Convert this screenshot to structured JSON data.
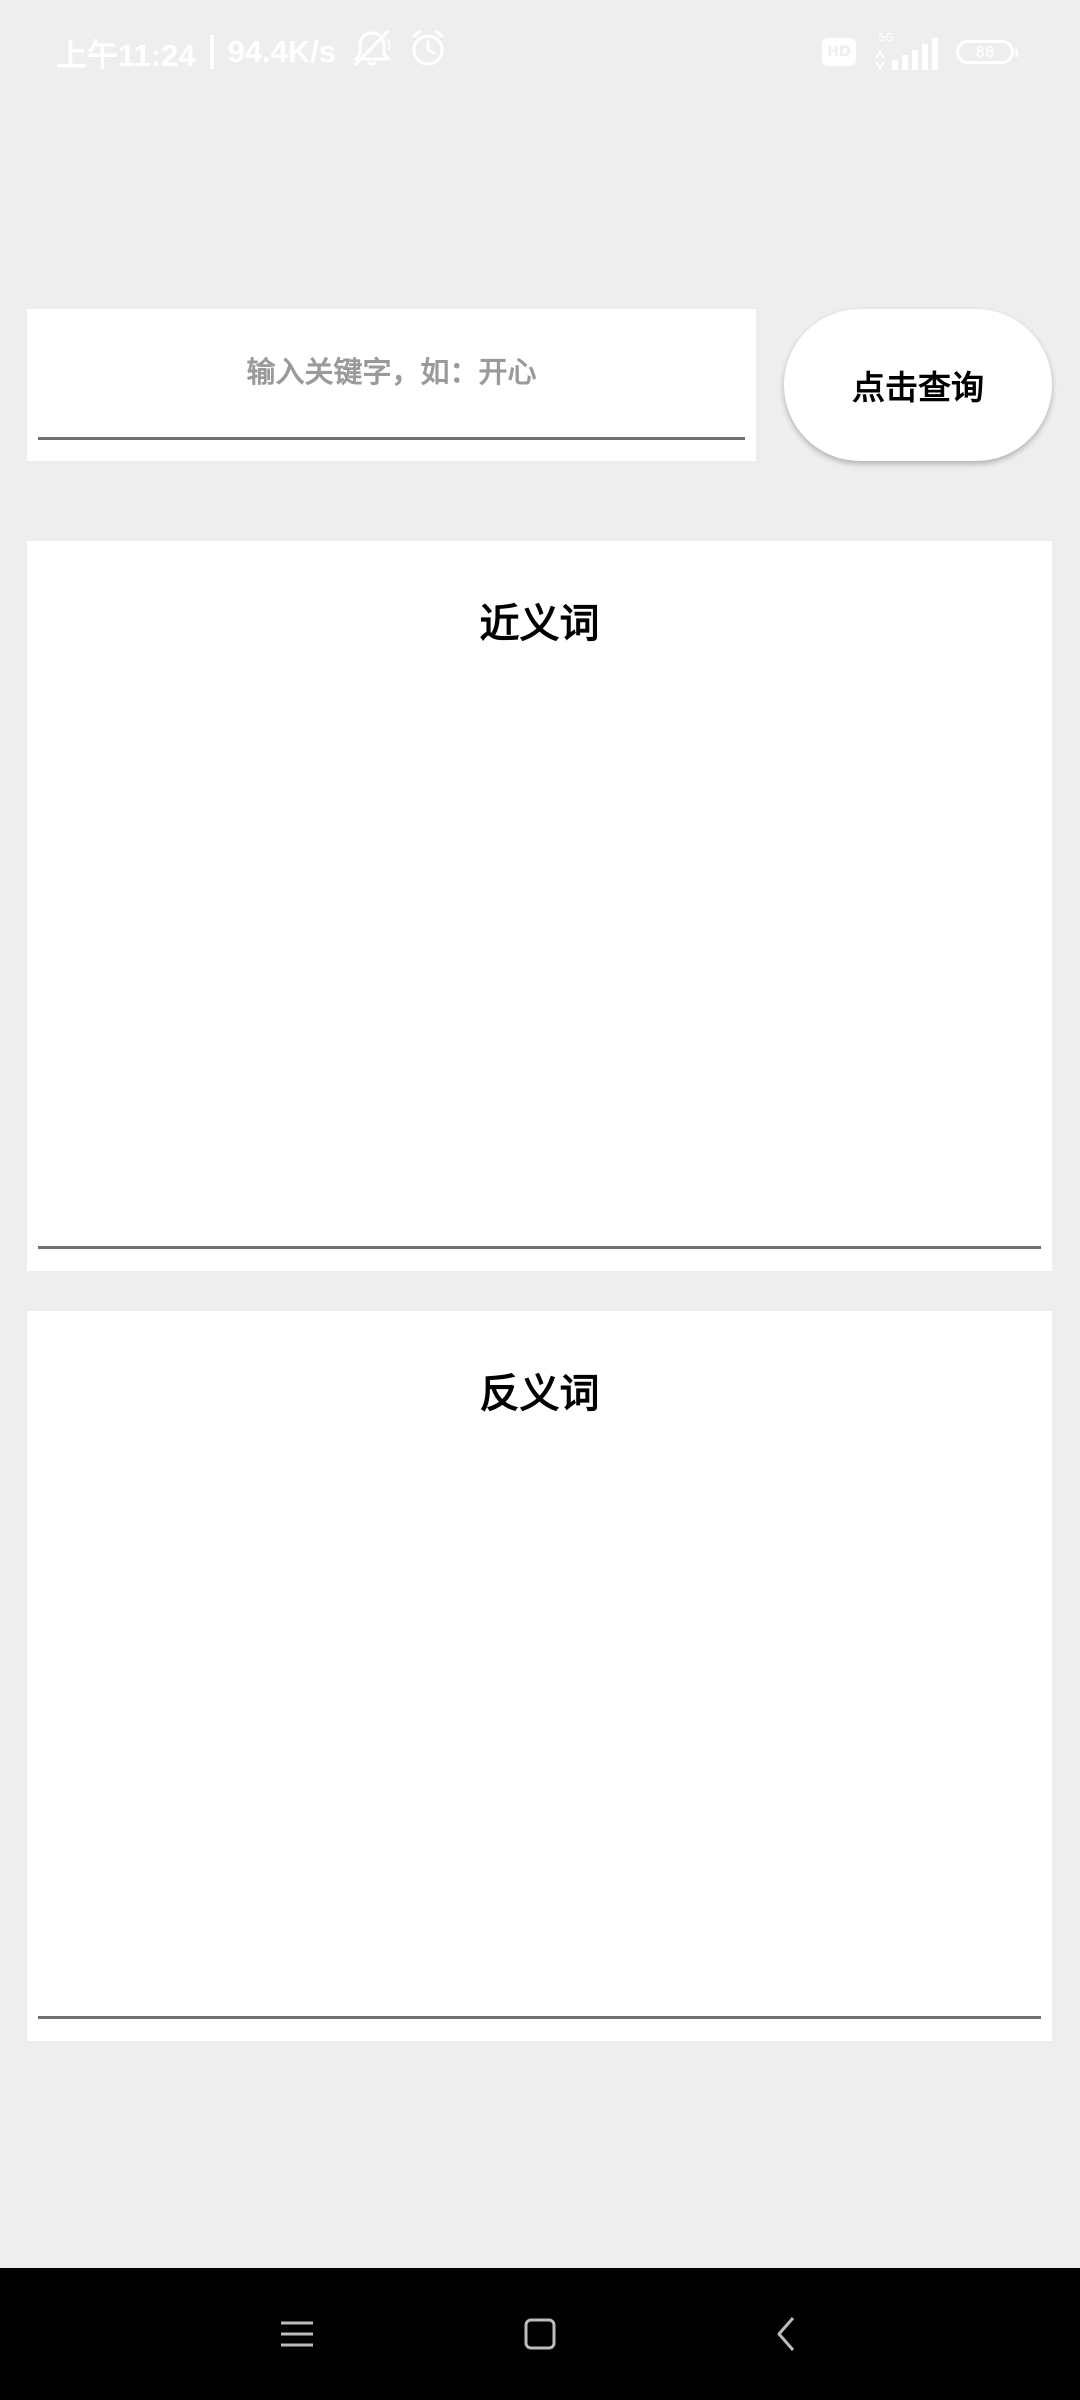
{
  "status_bar": {
    "time": "上午11:24",
    "network_speed": "94.4K/s",
    "hd_label": "HD",
    "network_type": "5G",
    "battery_level": "88",
    "icons": [
      "mute-icon",
      "alarm-icon",
      "hd-icon",
      "signal-icon",
      "battery-icon"
    ]
  },
  "search": {
    "placeholder": "输入关键字，如：开心",
    "value": "",
    "button_label": "点击查询"
  },
  "synonyms": {
    "title": "近义词",
    "content": ""
  },
  "antonyms": {
    "title": "反义词",
    "content": ""
  },
  "nav_bar": {
    "icons": [
      "menu-icon",
      "home-icon",
      "back-icon"
    ]
  },
  "colors": {
    "background": "#eeeeee",
    "card": "#ffffff",
    "underline": "#6f6f6f",
    "placeholder": "#9a9a9a",
    "nav_bar": "#000000"
  }
}
